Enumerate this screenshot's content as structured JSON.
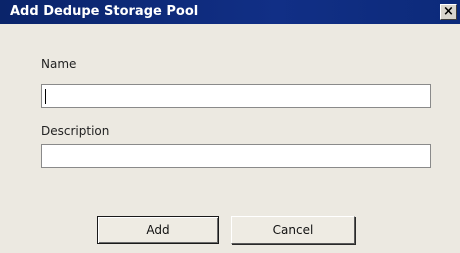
{
  "window": {
    "title": "Add Dedupe Storage Pool",
    "close_glyph": "×"
  },
  "form": {
    "name_label": "Name",
    "name_value": "",
    "description_label": "Description",
    "description_value": ""
  },
  "buttons": {
    "add_label": "Add",
    "cancel_label": "Cancel"
  },
  "colors": {
    "titlebar": "#0a246a",
    "dialog_background": "#ece9e1"
  }
}
